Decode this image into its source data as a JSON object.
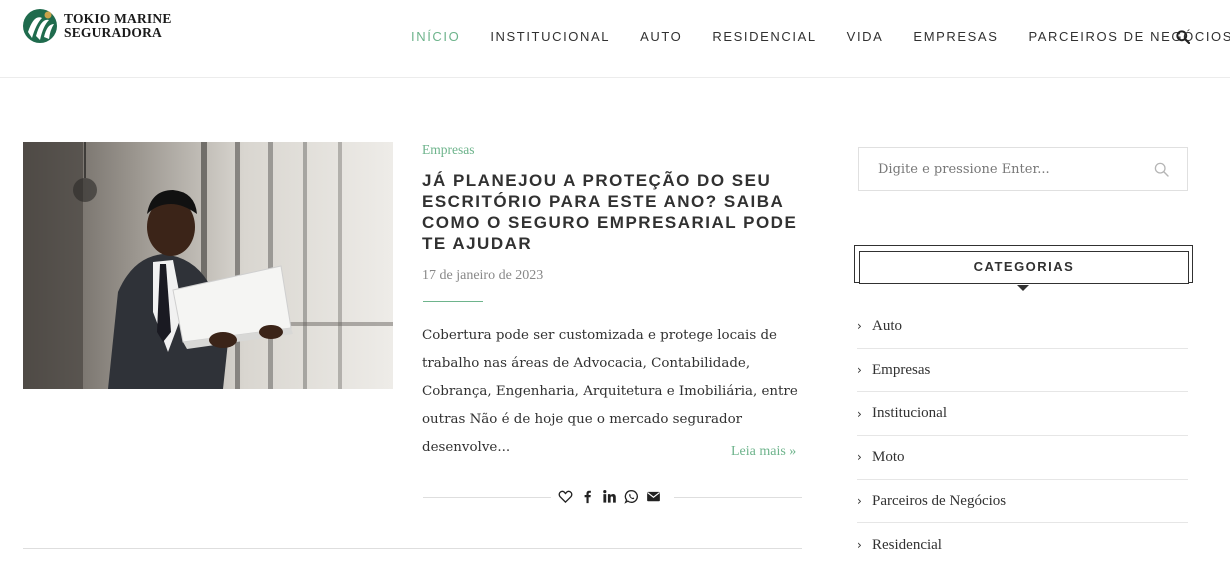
{
  "brand": {
    "line1": "TOKIO MARINE",
    "line2": "SEGURADORA",
    "colors": {
      "green": "#6eb48c",
      "dark_green": "#1f6b4d"
    }
  },
  "nav": {
    "items": [
      {
        "label": "INÍCIO",
        "active": true
      },
      {
        "label": "INSTITUCIONAL",
        "active": false
      },
      {
        "label": "AUTO",
        "active": false
      },
      {
        "label": "RESIDENCIAL",
        "active": false
      },
      {
        "label": "VIDA",
        "active": false
      },
      {
        "label": "EMPRESAS",
        "active": false
      },
      {
        "label": "PARCEIROS DE NEGÓCIOS",
        "active": false
      }
    ],
    "search_icon": "search-icon"
  },
  "post": {
    "category": "Empresas",
    "title": "JÁ PLANEJOU A PROTEÇÃO DO SEU ESCRITÓRIO PARA ESTE ANO? SAIBA COMO O SEGURO EMPRESARIAL PODE TE AJUDAR",
    "date": "17 de janeiro de 2023",
    "excerpt": "Cobertura pode ser customizada e protege locais de trabalho nas áreas de Advocacia, Contabilidade, Cobrança, Engenharia, Arquitetura e Imobiliária, entre outras Não é de hoje que o mercado segurador desenvolve...",
    "read_more": "Leia mais »",
    "share_icons": [
      "heart-icon",
      "facebook-icon",
      "linkedin-icon",
      "whatsapp-icon",
      "email-icon"
    ]
  },
  "sidebar": {
    "search_placeholder": "Digite e pressione Enter...",
    "categories_title": "CATEGORIAS",
    "categories": [
      {
        "label": "Auto"
      },
      {
        "label": "Empresas"
      },
      {
        "label": "Institucional"
      },
      {
        "label": "Moto"
      },
      {
        "label": "Parceiros de Negócios"
      },
      {
        "label": "Residencial"
      }
    ]
  }
}
